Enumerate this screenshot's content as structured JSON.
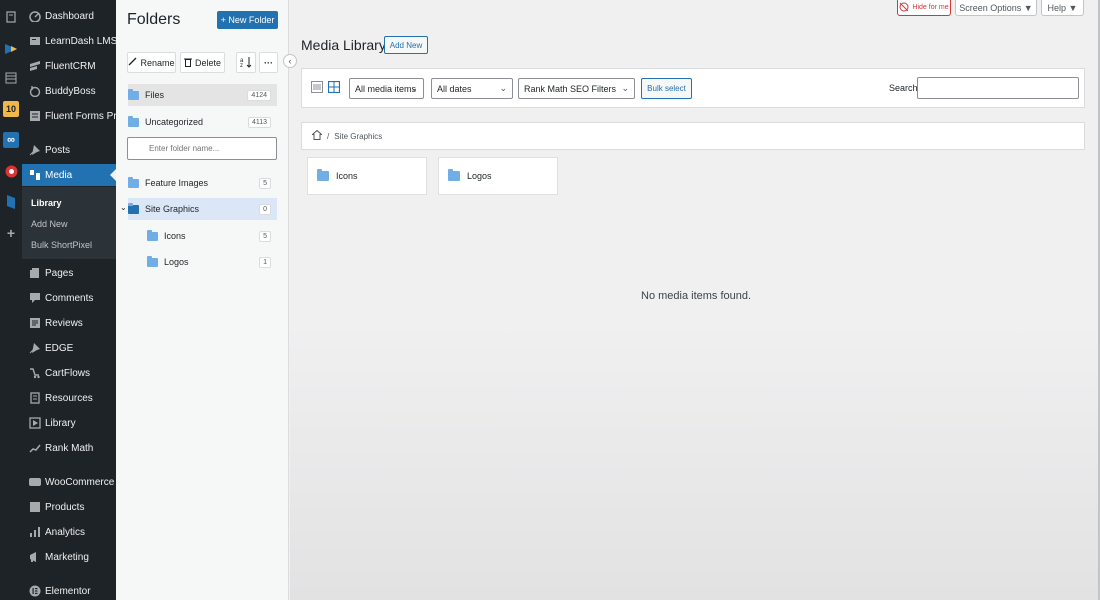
{
  "admin_menu": {
    "items": [
      {
        "label": "Dashboard",
        "icon": "dashboard-icon"
      },
      {
        "label": "LearnDash LMS",
        "icon": "learndash-icon"
      },
      {
        "label": "FluentCRM",
        "icon": "fluentcrm-icon"
      },
      {
        "label": "BuddyBoss",
        "icon": "buddyboss-icon"
      },
      {
        "label": "Fluent Forms Pro",
        "icon": "fluent-forms-icon"
      },
      {
        "label": "Posts",
        "icon": "pin-icon"
      },
      {
        "label": "Media",
        "icon": "media-icon"
      },
      {
        "label": "Pages",
        "icon": "pages-icon"
      },
      {
        "label": "Comments",
        "icon": "comments-icon"
      },
      {
        "label": "Reviews",
        "icon": "reviews-icon"
      },
      {
        "label": "EDGE",
        "icon": "pin-icon"
      },
      {
        "label": "CartFlows",
        "icon": "cartflows-icon"
      },
      {
        "label": "Resources",
        "icon": "resources-icon"
      },
      {
        "label": "Library",
        "icon": "library-icon"
      },
      {
        "label": "Rank Math",
        "icon": "rank-math-icon"
      },
      {
        "label": "WooCommerce",
        "icon": "woocommerce-icon"
      },
      {
        "label": "Products",
        "icon": "products-icon"
      },
      {
        "label": "Analytics",
        "icon": "analytics-icon"
      },
      {
        "label": "Marketing",
        "icon": "marketing-icon"
      },
      {
        "label": "Elementor",
        "icon": "elementor-icon"
      }
    ],
    "media_submenu": [
      "Library",
      "Add New",
      "Bulk ShortPixel"
    ]
  },
  "strip": {
    "calendar_badge": "10",
    "plus": "+"
  },
  "folders": {
    "title": "Folders",
    "new_folder": "+ New Folder",
    "rename": "Rename",
    "delete": "Delete",
    "more": "···",
    "collapse": "‹",
    "input_placeholder": "Enter folder name...",
    "top_items": [
      {
        "label": "Files",
        "count": "4124"
      },
      {
        "label": "Uncategorized",
        "count": "4113"
      }
    ],
    "tree": [
      {
        "label": "Feature Images",
        "count": "5"
      },
      {
        "label": "Site Graphics",
        "count": "0"
      },
      {
        "label": "Icons",
        "count": "5"
      },
      {
        "label": "Logos",
        "count": "1"
      }
    ]
  },
  "top_bar": {
    "hide_for_me": "Hide for me",
    "screen_options": "Screen Options ▼",
    "help": "Help ▼"
  },
  "main": {
    "title": "Media Library",
    "add_new": "Add New",
    "filters": {
      "media": "All media items",
      "dates": "All dates",
      "seo": "Rank Math SEO Filters"
    },
    "bulk_select": "Bulk select",
    "search_label": "Search",
    "breadcrumb": "Site Graphics",
    "folder_cards": [
      "Icons",
      "Logos"
    ],
    "empty_message": "No media items found."
  },
  "colors": {
    "menu_bg": "#1d2327",
    "accent": "#2271b1",
    "folder": "#72aee6"
  }
}
